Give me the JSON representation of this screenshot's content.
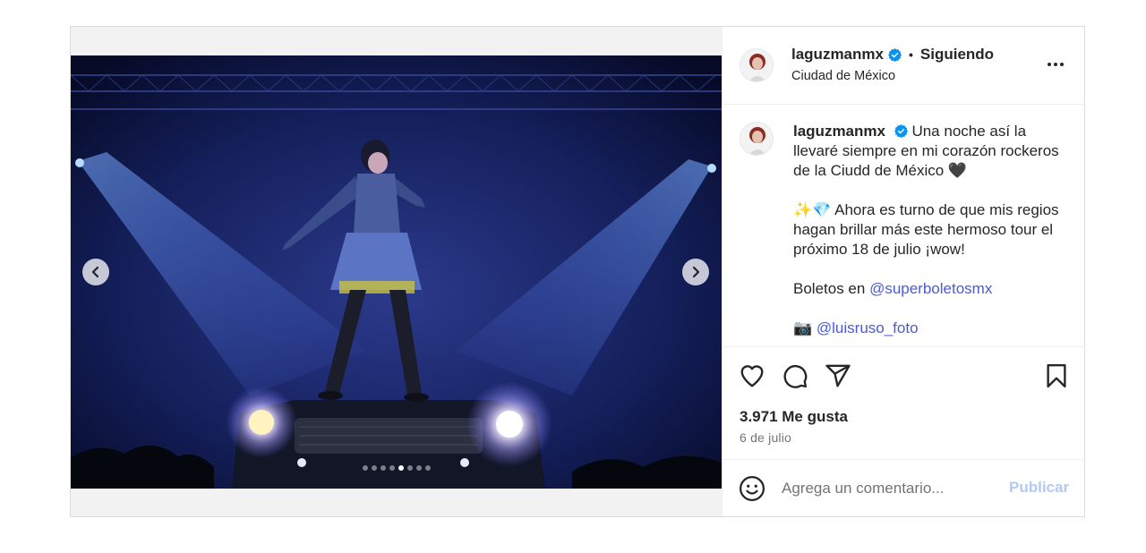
{
  "post": {
    "username": "laguzmanmx",
    "follow_status": "Siguiendo",
    "separator": "•",
    "location": "Ciudad de México",
    "caption": {
      "username": "laguzmanmx",
      "line1": "Una noche así la llevaré siempre en mi corazón rockeros de la Ciudd de México 🖤",
      "line2": "✨💎 Ahora es turno de que mis regios hagan brillar más este hermoso tour el próximo 18 de julio ¡wow!",
      "line3_prefix": "Boletos en ",
      "line3_mention": "@superboletosmx",
      "line4_prefix": "📷 ",
      "line4_mention": "@luisruso_foto"
    },
    "likes": "3.971 Me gusta",
    "date": "6 de julio",
    "comment_placeholder": "Agrega un comentario...",
    "publish_label": "Publicar"
  },
  "carousel": {
    "total": 8,
    "active_index": 4
  },
  "icons": {
    "verified": "verified-badge-icon",
    "more": "more-options-icon",
    "like": "heart-icon",
    "comment": "comment-icon",
    "share": "share-icon",
    "save": "bookmark-icon",
    "emoji": "emoji-icon",
    "prev": "chevron-left-icon",
    "next": "chevron-right-icon"
  },
  "colors": {
    "verified_blue": "#0095f6",
    "link": "#4a5bd9",
    "publish_disabled": "#b2c9f5"
  }
}
